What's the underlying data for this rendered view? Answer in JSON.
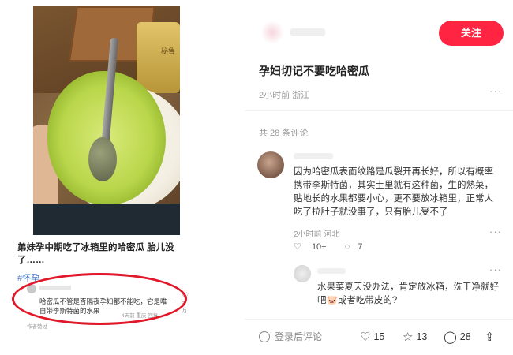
{
  "left_card": {
    "photo_bag_text": "秘鲁",
    "note_title": "弟妹孕中期吃了冰箱里的哈密瓜 胎儿没了……",
    "hashtag": "#怀孕",
    "mini_comment": {
      "text": "哈密瓜不管是否隔夜孕妇都不能吃，它是唯一自带李斯特菌的水果",
      "likes": "9万",
      "meta": "4天前 重庆 回复"
    },
    "author_note": "作者赞过"
  },
  "detail": {
    "follow_label": "关注",
    "headline": "孕妇切记不要吃哈密瓜",
    "meta": "2小时前 浙江",
    "more": "···",
    "comment_count": "共 28 条评论",
    "comment1": {
      "text": "因为哈密瓜表面纹路是瓜裂开再长好，所以有概率携带李斯特菌，其实土里就有这种菌，生的熟菜，贴地长的水果都要小心，更不要放冰箱里，正常人吃了拉肚子就没事了，只有胎儿受不了",
      "meta": "2小时前 河北",
      "likes": "10+",
      "replies": "7"
    },
    "comment2": {
      "text": "水果菜夏天没办法，肯定放冰箱，洗干净就好吧🐷或者吃带皮的?"
    }
  },
  "bottom_bar": {
    "comment_placeholder": "登录后评论",
    "like_count": "15",
    "fav_count": "13",
    "comment_count": "28"
  },
  "colors": {
    "brand_red": "#ff2442",
    "highlight_red": "#e0182a",
    "tag_blue": "#4a78c9"
  }
}
